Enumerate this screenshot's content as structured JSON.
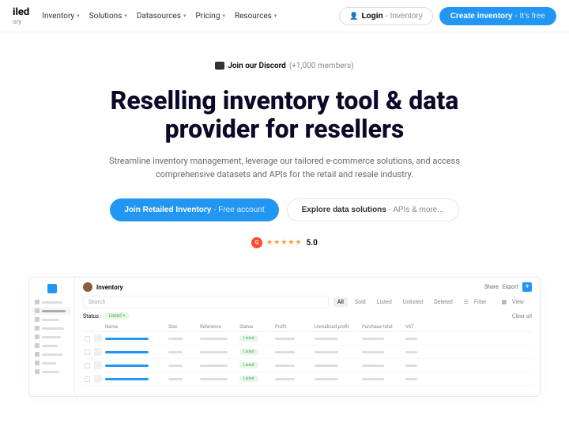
{
  "logo": {
    "text": "iled",
    "sub": "ory"
  },
  "nav": [
    {
      "label": "Inventory"
    },
    {
      "label": "Solutions"
    },
    {
      "label": "Datasources"
    },
    {
      "label": "Pricing"
    },
    {
      "label": "Resources"
    }
  ],
  "login": {
    "bold": "Login",
    "light": " - Inventory"
  },
  "create": {
    "bold": "Create inventory",
    "light": " - It's free"
  },
  "discord": {
    "bold": "Join our Discord",
    "count": "(+1,000 members)"
  },
  "h1_a": "Reselling inventory tool & data",
  "h1_b": "provider for resellers",
  "sub": "Streamline inventory management, leverage our tailored e-commerce solutions, and access comprehensive datasets and APIs for the retail and resale industry.",
  "cta_p": {
    "bold": "Join Retailed Inventory",
    "light": " - Free account"
  },
  "cta_s": {
    "bold": "Explore data solutions",
    "light": " - APIs & more..."
  },
  "rating": {
    "badge": "G",
    "stars": "★★★★★",
    "value": "5.0"
  },
  "preview": {
    "title": "Inventory",
    "actions": {
      "share": "Share",
      "export": "Export"
    },
    "search": "Search",
    "filters": {
      "all": "All",
      "sold": "Sold",
      "listed": "Listed",
      "unlisted": "Unlisted",
      "deleted": "Deleted",
      "filter": "Filter",
      "view": "View"
    },
    "status_label": "Status :",
    "status_badge": "Listed",
    "clear": "Clear all",
    "cols": {
      "name": "Name",
      "size": "Size",
      "reference": "Reference",
      "status": "Status",
      "profit": "Profit",
      "unrealized": "Unrealized profit",
      "purchase": "Purchase total",
      "vat": "VAT"
    },
    "row_status": "Listed"
  }
}
